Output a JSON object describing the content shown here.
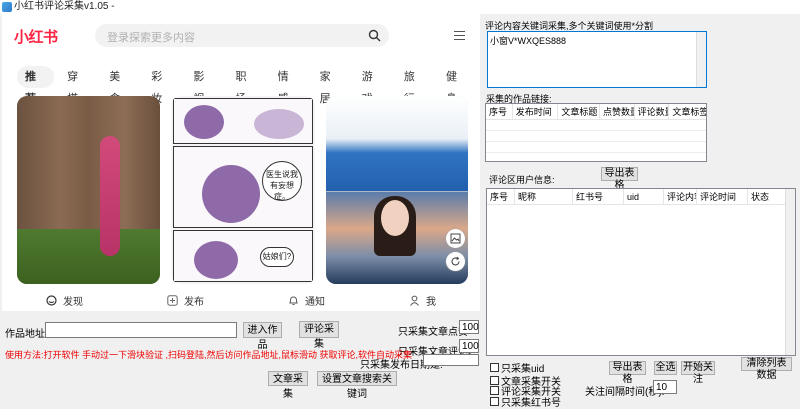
{
  "window": {
    "title": "小红书评论采集v1.05 -"
  },
  "web": {
    "logo": "小红书",
    "search_placeholder": "登录探索更多内容",
    "tabs": [
      "推荐",
      "穿搭",
      "美食",
      "彩妆",
      "影视",
      "职场",
      "情感",
      "家居",
      "游戏",
      "旅行",
      "健身"
    ],
    "comic_bubble1": "医生说我有妄想症。",
    "comic_bubble2": "姑娘们?",
    "nav": {
      "discover": "发现",
      "publish": "发布",
      "notify": "通知",
      "me": "我"
    }
  },
  "left_controls": {
    "url_label": "作品地址:",
    "url_value": "",
    "enter_button": "进入作品",
    "collect_comments_button": "评论采集",
    "likes_label": "只采集文章点赞>",
    "likes_value": "100",
    "comments_label": "只采集文章评论>",
    "comments_value": "100",
    "date_label": "只采集发布日期是:",
    "date_value": "",
    "usage_text": "使用方法:打开软件 手动过一下滑块验证 ,扫码登陆,然后访问作品地址,鼠标滑动 获取评论,软件自动采集",
    "article_collect_button": "文章采集",
    "set_keywords_button": "设置文章搜索关键词"
  },
  "right_panel": {
    "keywords_label": "评论内容关键词采集,多个关键词使用*分割",
    "keywords_value": "小窗V*WXQES888",
    "works_label": "采集的作品链接:",
    "works_columns": [
      "序号",
      "发布时间",
      "文章标题",
      "点赞数量",
      "评论数量",
      "文章标签"
    ],
    "export_button_1": "导出表格",
    "users_label": "评论区用户信息:",
    "users_columns": [
      "序号",
      "昵称",
      "红书号",
      "uid",
      "评论内容",
      "评论时间",
      "状态"
    ],
    "checkboxes": [
      "只采集uid",
      "文章采集开关",
      "评论采集开关",
      "只采集红书号"
    ],
    "export_button_2": "导出表格",
    "select_all_button": "全选",
    "start_follow_button": "开始关注",
    "clear_list_button": "清除列表数据",
    "follow_interval_label": "关注间隔时间(秒):",
    "follow_interval_value": "10"
  },
  "colors": {
    "brand": "#ff2442",
    "usage_text": "#e00000",
    "focus_border": "#0078d7"
  }
}
